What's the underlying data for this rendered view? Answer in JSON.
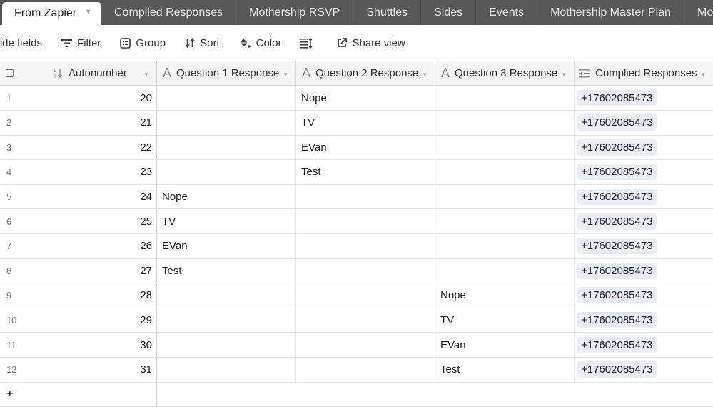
{
  "tabs": [
    {
      "label": "From Zapier",
      "active": true
    },
    {
      "label": "Complied Responses",
      "active": false
    },
    {
      "label": "Mothership RSVP",
      "active": false
    },
    {
      "label": "Shuttles",
      "active": false
    },
    {
      "label": "Sides",
      "active": false
    },
    {
      "label": "Events",
      "active": false
    },
    {
      "label": "Mothership Master Plan",
      "active": false
    },
    {
      "label": "Mo",
      "active": false
    }
  ],
  "toolbar": {
    "hide_fields": "Hide fields",
    "filter": "Filter",
    "group": "Group",
    "sort": "Sort",
    "color": "Color",
    "share_view": "Share view"
  },
  "columns": {
    "autonumber": "Autonumber",
    "q1": "Question 1 Response",
    "q2": "Question 2 Response",
    "q3": "Question 3 Response",
    "complied": "Complied Responses"
  },
  "rows": [
    {
      "n": "1",
      "auto": "20",
      "q1": "",
      "q2": "Nope",
      "q3": "",
      "cr": "+17602085473"
    },
    {
      "n": "2",
      "auto": "21",
      "q1": "",
      "q2": "TV",
      "q3": "",
      "cr": "+17602085473"
    },
    {
      "n": "3",
      "auto": "22",
      "q1": "",
      "q2": "EVan",
      "q3": "",
      "cr": "+17602085473"
    },
    {
      "n": "4",
      "auto": "23",
      "q1": "",
      "q2": "Test",
      "q3": "",
      "cr": "+17602085473"
    },
    {
      "n": "5",
      "auto": "24",
      "q1": "Nope",
      "q2": "",
      "q3": "",
      "cr": "+17602085473"
    },
    {
      "n": "6",
      "auto": "25",
      "q1": "TV",
      "q2": "",
      "q3": "",
      "cr": "+17602085473"
    },
    {
      "n": "7",
      "auto": "26",
      "q1": "EVan",
      "q2": "",
      "q3": "",
      "cr": "+17602085473"
    },
    {
      "n": "8",
      "auto": "27",
      "q1": "Test",
      "q2": "",
      "q3": "",
      "cr": "+17602085473"
    },
    {
      "n": "9",
      "auto": "28",
      "q1": "",
      "q2": "",
      "q3": "Nope",
      "cr": "+17602085473"
    },
    {
      "n": "10",
      "auto": "29",
      "q1": "",
      "q2": "",
      "q3": "TV",
      "cr": "+17602085473"
    },
    {
      "n": "11",
      "auto": "30",
      "q1": "",
      "q2": "",
      "q3": "EVan",
      "cr": "+17602085473"
    },
    {
      "n": "12",
      "auto": "31",
      "q1": "",
      "q2": "",
      "q3": "Test",
      "cr": "+17602085473"
    }
  ],
  "add_row_label": "+"
}
